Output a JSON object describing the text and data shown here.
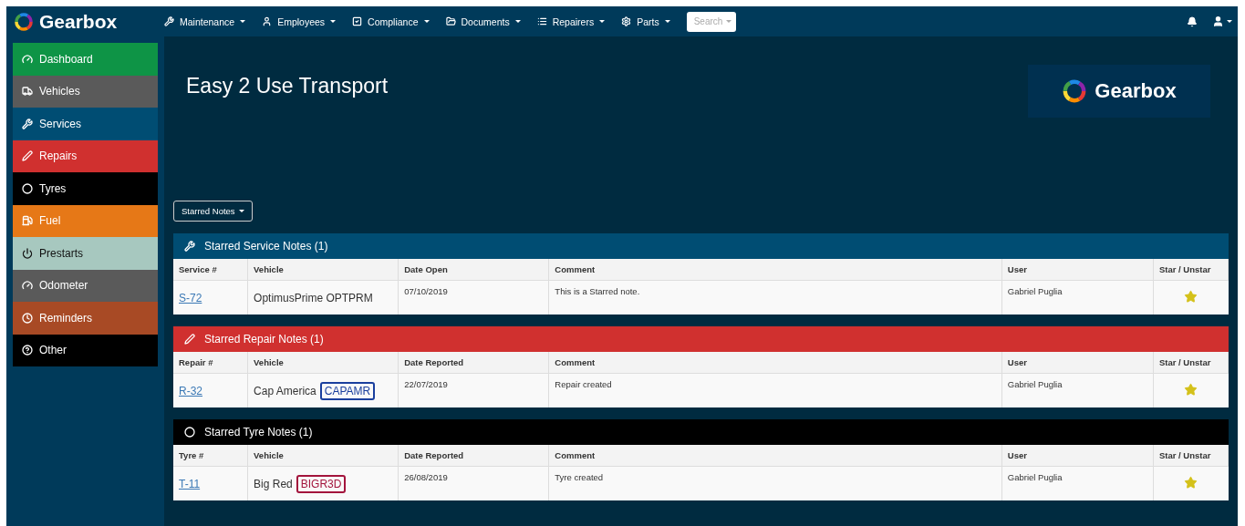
{
  "brand": "Gearbox",
  "nav": [
    {
      "label": "Maintenance",
      "kind": "wrench"
    },
    {
      "label": "Employees",
      "kind": "user"
    },
    {
      "label": "Compliance",
      "kind": "check"
    },
    {
      "label": "Documents",
      "kind": "folder"
    },
    {
      "label": "Repairers",
      "kind": "list"
    },
    {
      "label": "Parts",
      "kind": "gear"
    }
  ],
  "search": {
    "placeholder": "Search"
  },
  "sidebar": {
    "items": [
      {
        "label": "Dashboard",
        "kind": "gauge",
        "color": "#0e9446"
      },
      {
        "label": "Vehicles",
        "kind": "truck",
        "color": "#5a5a5a"
      },
      {
        "label": "Services",
        "kind": "wrench",
        "color": "#004d73"
      },
      {
        "label": "Repairs",
        "kind": "screwdriver",
        "color": "#d0302f"
      },
      {
        "label": "Tyres",
        "kind": "ring",
        "color": "#000000"
      },
      {
        "label": "Fuel",
        "kind": "fuel",
        "color": "#e67817"
      },
      {
        "label": "Prestarts",
        "kind": "power",
        "color": "#a7c8bf"
      },
      {
        "label": "Odometer",
        "kind": "gauge",
        "color": "#5a5a5a"
      },
      {
        "label": "Reminders",
        "kind": "clock",
        "color": "#a84a25"
      },
      {
        "label": "Other",
        "kind": "help",
        "color": "#000000"
      }
    ]
  },
  "page_title": "Easy 2 Use Transport",
  "logo_text": "Gearbox",
  "filter_button": "Starred Notes",
  "sections": [
    {
      "title": "Starred Service Notes (1)",
      "kind": "wrench",
      "color": "#004d73",
      "columns": [
        "Service #",
        "Vehicle",
        "Date Open",
        "Comment",
        "User",
        "Star / Unstar"
      ],
      "rows": [
        {
          "id": "S-72",
          "vehicle": "OptimusPrime OPTPRM",
          "date": "07/10/2019",
          "comment": "This is a Starred note.",
          "user": "Gabriel Puglia",
          "starred": true
        }
      ]
    },
    {
      "title": "Starred Repair Notes (1)",
      "kind": "screwdriver",
      "color": "#d0302f",
      "columns": [
        "Repair #",
        "Vehicle",
        "Date Reported",
        "Comment",
        "User",
        "Star / Unstar"
      ],
      "rows": [
        {
          "id": "R-32",
          "vehicle": "Cap America",
          "plate": {
            "text": "CAPAMR",
            "color": "#1a3f9e"
          },
          "date": "22/07/2019",
          "comment": "Repair created",
          "user": "Gabriel Puglia",
          "starred": true
        }
      ]
    },
    {
      "title": "Starred Tyre Notes (1)",
      "kind": "ring",
      "color": "#000000",
      "columns": [
        "Tyre #",
        "Vehicle",
        "Date Reported",
        "Comment",
        "User",
        "Star / Unstar"
      ],
      "rows": [
        {
          "id": "T-11",
          "vehicle": "Big Red",
          "plate": {
            "text": "BIGR3D",
            "color": "#a3143c"
          },
          "date": "26/08/2019",
          "comment": "Tyre created",
          "user": "Gabriel Puglia",
          "starred": true
        }
      ]
    }
  ]
}
